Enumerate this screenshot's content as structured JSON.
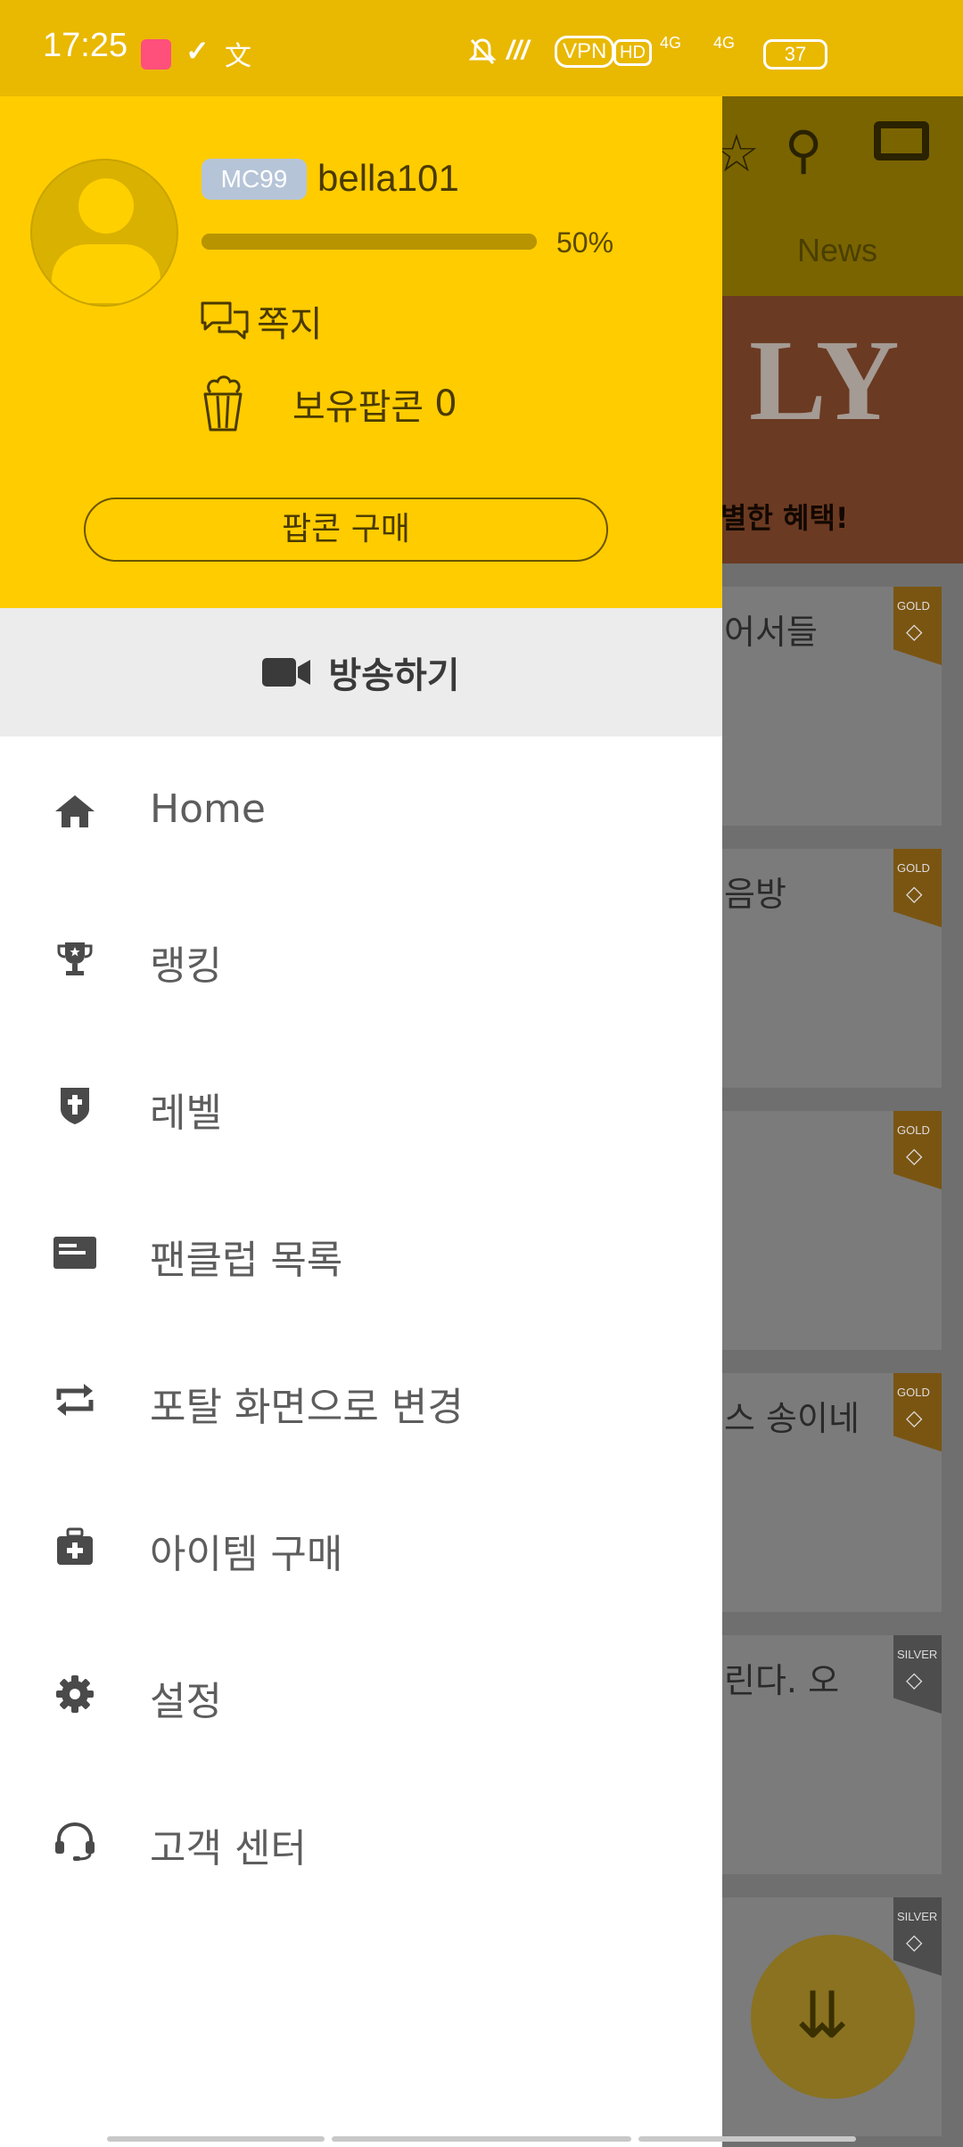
{
  "status_bar": {
    "time": "17:25",
    "vpn": "VPN",
    "hd": "HD",
    "network1": "4G",
    "network2": "4G",
    "battery": "37"
  },
  "background": {
    "tab_news": "News",
    "banner_big": "LY",
    "banner_sub": "별한 혜택!",
    "cards": [
      {
        "text": "어서들",
        "badge": "GOLD"
      },
      {
        "text": "음방",
        "badge": "GOLD"
      },
      {
        "text": "",
        "badge": "GOLD"
      },
      {
        "text": "스 송이네",
        "badge": "GOLD"
      },
      {
        "text": "린다. 오",
        "badge": "SILVER"
      },
      {
        "text": "",
        "badge": "SILVER"
      }
    ]
  },
  "drawer": {
    "profile": {
      "level_badge": "MC99",
      "username": "bella101",
      "exp_fraction": 1.0,
      "exp_label": "50%"
    },
    "message_label": "쪽지",
    "popcorn_label": "보유팝콘",
    "popcorn_count": "0",
    "buy_popcorn_label": "팝콘 구매",
    "broadcast_label": "방송하기",
    "menu": [
      {
        "label": "Home",
        "icon": "home-icon"
      },
      {
        "label": "랭킹",
        "icon": "trophy-icon"
      },
      {
        "label": "레벨",
        "icon": "shield-icon"
      },
      {
        "label": "팬클럽 목록",
        "icon": "card-icon"
      },
      {
        "label": "포탈 화면으로 변경",
        "icon": "repeat-icon"
      },
      {
        "label": "아이템 구매",
        "icon": "medical-bag-icon"
      },
      {
        "label": "설정",
        "icon": "gear-icon"
      },
      {
        "label": "고객 센터",
        "icon": "headset-icon"
      }
    ]
  },
  "colors": {
    "status_bar": "#E9B800",
    "drawer_header": "#FFCC00",
    "icon": "#4a4a4a",
    "menu_text": "#5d5d5d"
  }
}
